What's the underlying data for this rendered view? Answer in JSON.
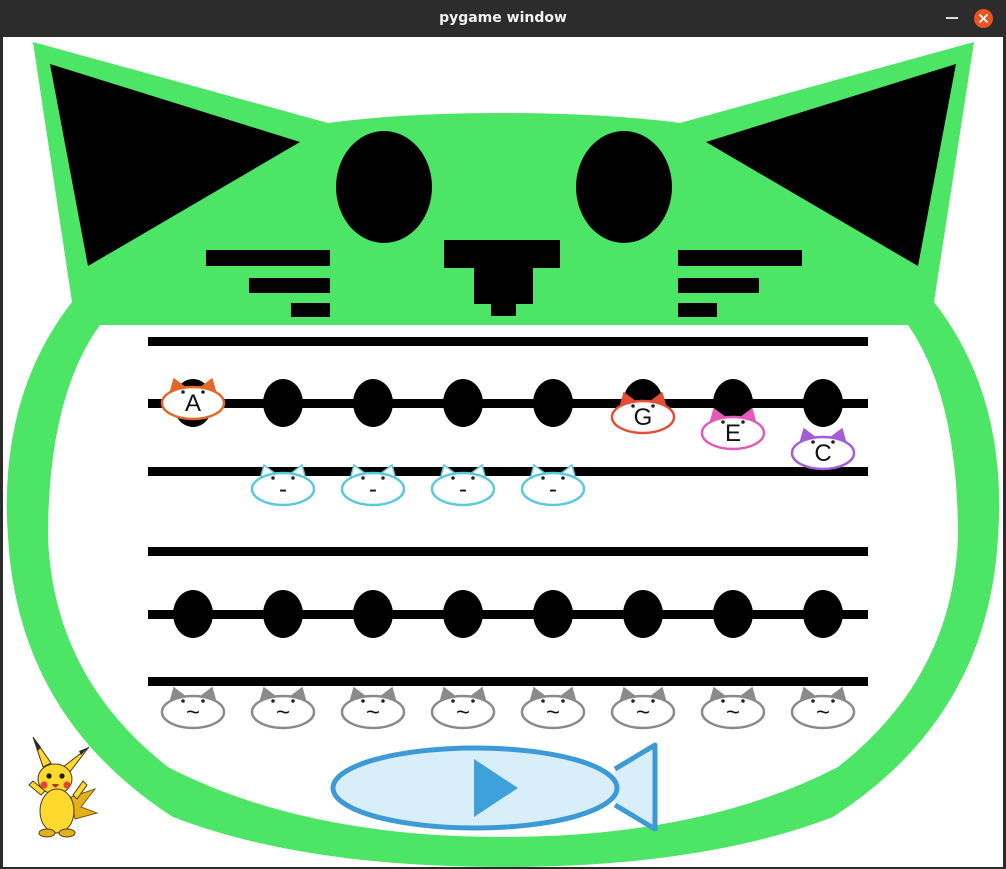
{
  "window": {
    "title": "pygame window",
    "controls": {
      "minimize_icon": "minimize-icon",
      "close_icon": "close-icon"
    }
  },
  "colors": {
    "cat_green": "#4ce565",
    "ink": "#000000",
    "fish_fill": "#d8eef8",
    "fish_stroke": "#3c9ad6",
    "play": "#3fa1da",
    "note_orange": "#e0692a",
    "note_red": "#e64d33",
    "note_pink": "#e35ab8",
    "note_purple": "#a55bd6",
    "rest_blue": "#5cc8e0",
    "rest_gray": "#8a8a8a"
  },
  "staff_top": {
    "note_row": [
      {
        "type": "note",
        "label": "A",
        "color": "#e0692a"
      },
      {
        "type": "empty"
      },
      {
        "type": "empty"
      },
      {
        "type": "empty"
      },
      {
        "type": "empty"
      },
      {
        "type": "note",
        "label": "G",
        "color": "#e64d33"
      },
      {
        "type": "note",
        "label": "E",
        "color": "#e35ab8"
      },
      {
        "type": "note",
        "label": "C",
        "color": "#a55bd6"
      }
    ],
    "rest_row": [
      {
        "slot": 2,
        "label": "-",
        "color": "#5cc8e0"
      },
      {
        "slot": 3,
        "label": "-",
        "color": "#5cc8e0"
      },
      {
        "slot": 4,
        "label": "-",
        "color": "#5cc8e0"
      },
      {
        "slot": 5,
        "label": "-",
        "color": "#5cc8e0"
      }
    ]
  },
  "staff_bottom": {
    "note_row": [
      {
        "type": "empty"
      },
      {
        "type": "empty"
      },
      {
        "type": "empty"
      },
      {
        "type": "empty"
      },
      {
        "type": "empty"
      },
      {
        "type": "empty"
      },
      {
        "type": "empty"
      },
      {
        "type": "empty"
      }
    ],
    "rest_row": [
      {
        "slot": 1,
        "label": "~",
        "color": "#8a8a8a"
      },
      {
        "slot": 2,
        "label": "~",
        "color": "#8a8a8a"
      },
      {
        "slot": 3,
        "label": "~",
        "color": "#8a8a8a"
      },
      {
        "slot": 4,
        "label": "~",
        "color": "#8a8a8a"
      },
      {
        "slot": 5,
        "label": "~",
        "color": "#8a8a8a"
      },
      {
        "slot": 6,
        "label": "~",
        "color": "#8a8a8a"
      },
      {
        "slot": 7,
        "label": "~",
        "color": "#8a8a8a"
      },
      {
        "slot": 8,
        "label": "~",
        "color": "#8a8a8a"
      }
    ]
  },
  "play_button": {
    "icon": "play-icon",
    "shape": "fish"
  },
  "mascot": {
    "icon": "pikachu-icon"
  }
}
